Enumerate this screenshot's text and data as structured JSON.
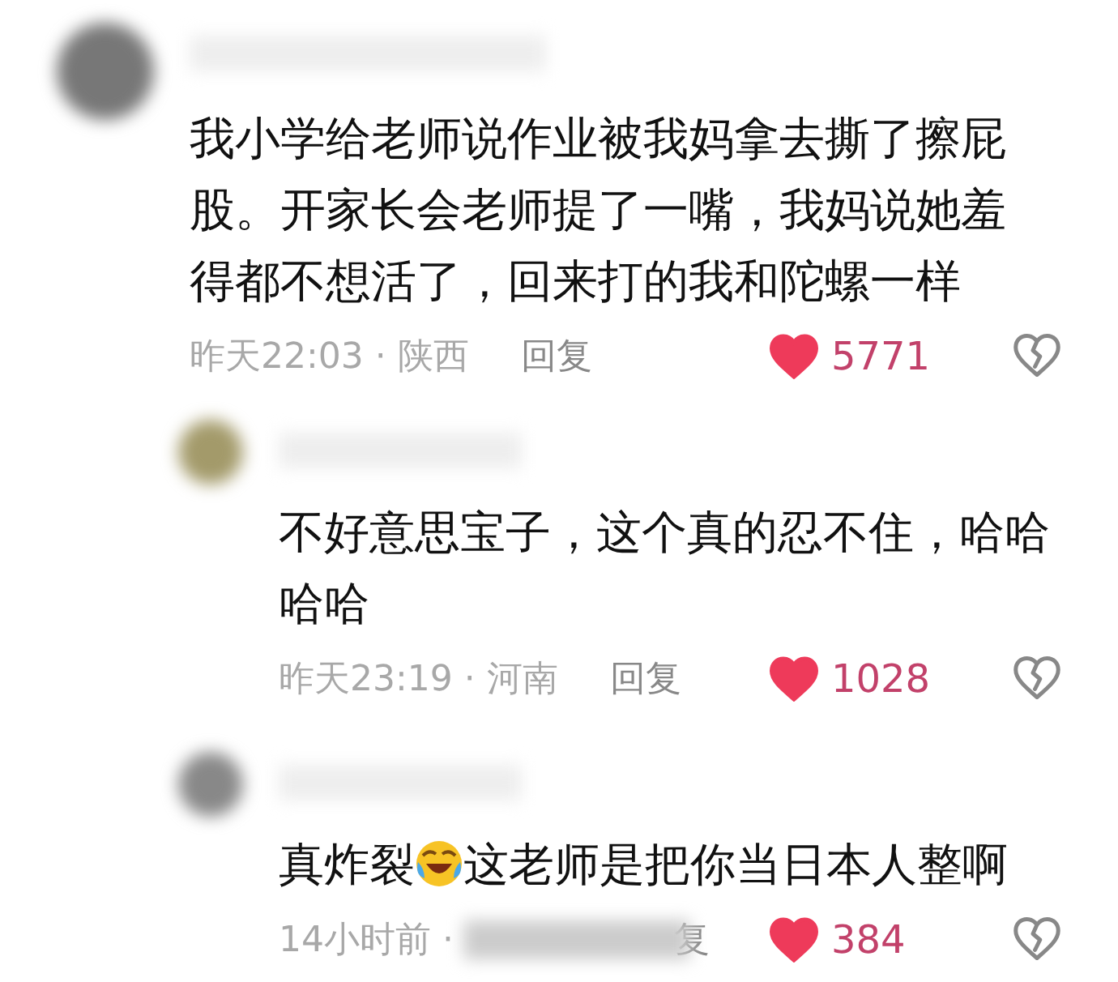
{
  "comments": [
    {
      "kind": "top",
      "segments": [
        {
          "kind": "text",
          "text": "我小学给老师说作业被我妈拿去撕了擦屁股。开家长会老师提了一嘴，我妈说她羞得都不想活了，回来打的我和陀螺一样"
        }
      ],
      "meta": "昨天22:03 · 陕西",
      "reply": "回复",
      "liked": true,
      "likes": "5771"
    },
    {
      "kind": "reply",
      "segments": [
        {
          "kind": "text",
          "text": "不好意思宝子，这个真的忍不住，哈哈哈哈"
        }
      ],
      "meta": "昨天23:19 · 河南",
      "reply": "回复",
      "liked": true,
      "likes": "1028"
    },
    {
      "kind": "reply",
      "segments": [
        {
          "kind": "text",
          "text": "真炸裂"
        },
        {
          "kind": "emoji"
        },
        {
          "kind": "text",
          "text": "这老师是把你当日本人整啊"
        }
      ],
      "meta": "14小时前 ·",
      "meta_blurred": true,
      "reply": "复",
      "liked": true,
      "likes": "384"
    }
  ]
}
